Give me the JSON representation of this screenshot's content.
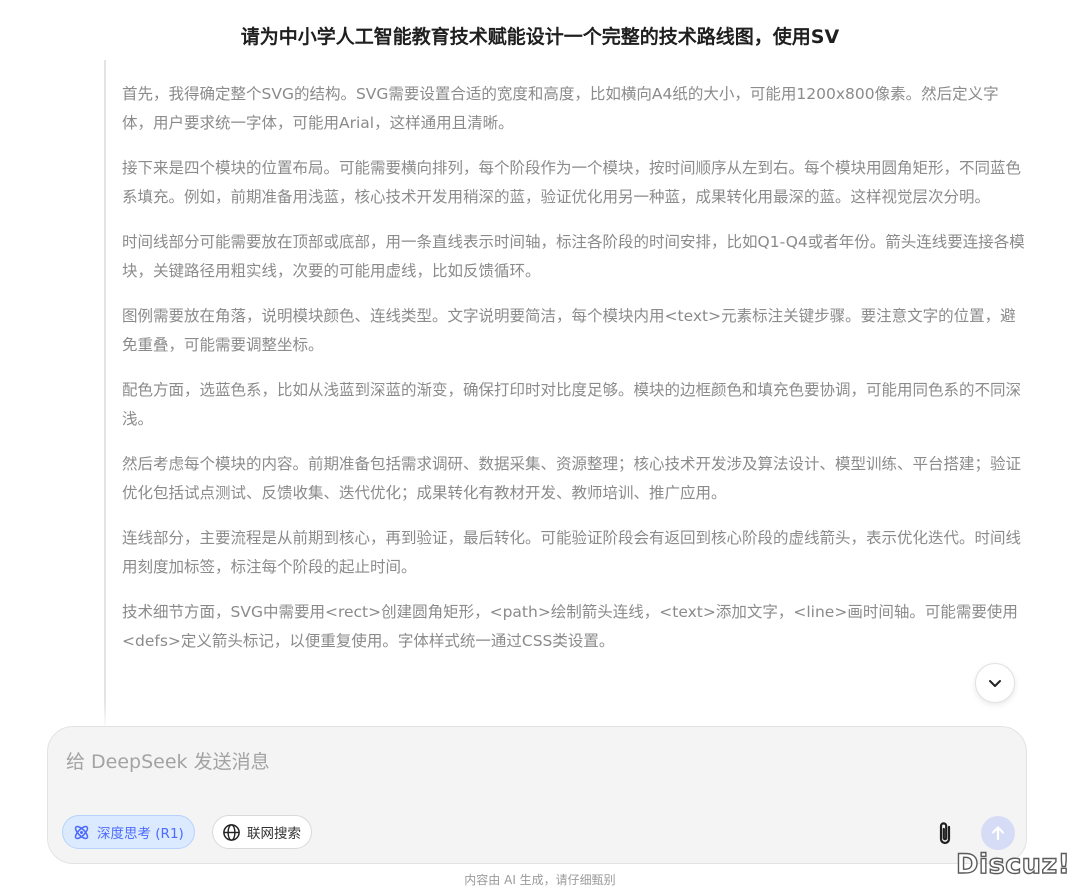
{
  "chat": {
    "title": "请为中小学人工智能教育技术赋能设计一个完整的技术路线图，使用SV"
  },
  "thinking": {
    "paragraphs": [
      "首先，我得确定整个SVG的结构。SVG需要设置合适的宽度和高度，比如横向A4纸的大小，可能用1200x800像素。然后定义字体，用户要求统一字体，可能用Arial，这样通用且清晰。",
      "接下来是四个模块的位置布局。可能需要横向排列，每个阶段作为一个模块，按时间顺序从左到右。每个模块用圆角矩形，不同蓝色系填充。例如，前期准备用浅蓝，核心技术开发用稍深的蓝，验证优化用另一种蓝，成果转化用最深的蓝。这样视觉层次分明。",
      "时间线部分可能需要放在顶部或底部，用一条直线表示时间轴，标注各阶段的时间安排，比如Q1-Q4或者年份。箭头连线要连接各模块，关键路径用粗实线，次要的可能用虚线，比如反馈循环。",
      "图例需要放在角落，说明模块颜色、连线类型。文字说明要简洁，每个模块内用<text>元素标注关键步骤。要注意文字的位置，避免重叠，可能需要调整坐标。",
      "配色方面，选蓝色系，比如从浅蓝到深蓝的渐变，确保打印时对比度足够。模块的边框颜色和填充色要协调，可能用同色系的不同深浅。",
      "然后考虑每个模块的内容。前期准备包括需求调研、数据采集、资源整理；核心技术开发涉及算法设计、模型训练、平台搭建；验证优化包括试点测试、反馈收集、迭代优化；成果转化有教材开发、教师培训、推广应用。",
      "连线部分，主要流程是从前期到核心，再到验证，最后转化。可能验证阶段会有返回到核心阶段的虚线箭头，表示优化迭代。时间线用刻度加标签，标注每个阶段的起止时间。",
      "技术细节方面，SVG中需要用<rect>创建圆角矩形，<path>绘制箭头连线，<text>添加文字，<line>画时间轴。可能需要使用<defs>定义箭头标记，以便重复使用。字体样式统一通过CSS类设置。"
    ]
  },
  "composer": {
    "placeholder": "给 DeepSeek 发送消息",
    "value": "",
    "deep_think_label": "深度思考 (R1)",
    "web_search_label": "联网搜索"
  },
  "footer": {
    "disclaimer": "内容由 AI 生成，请仔细甄别"
  },
  "watermark": {
    "text": "Discuz!"
  },
  "icons": {
    "scroll_down": "chevron-down-icon",
    "deep_think": "atom-icon",
    "web_search": "globe-icon",
    "attach": "paperclip-icon",
    "send": "arrow-up-icon"
  },
  "colors": {
    "accent": "#4d6bfe",
    "accent_soft": "#dbeafe",
    "send_disabled": "#d6dcf5",
    "thinking_text": "#8b8b8b",
    "title_text": "#1f1f1f"
  }
}
